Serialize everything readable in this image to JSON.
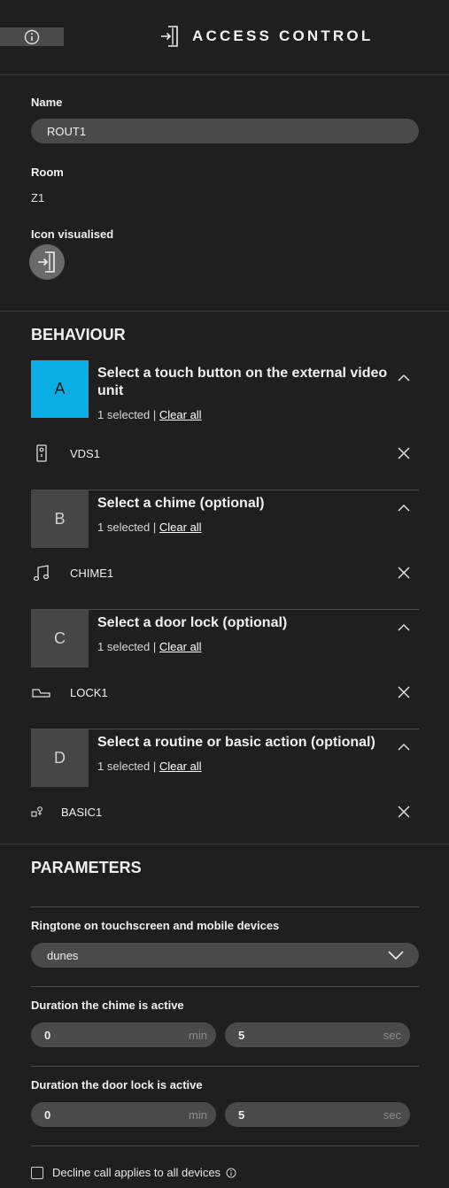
{
  "header": {
    "title": "ACCESS CONTROL",
    "info_icon": "info-icon",
    "title_icon": "access-door-icon"
  },
  "general": {
    "name_label": "Name",
    "name_value": "ROUT1",
    "room_label": "Room",
    "room_value": "Z1",
    "icon_label": "Icon visualised",
    "icon_name": "access-door-icon"
  },
  "behaviour": {
    "title": "BEHAVIOUR",
    "steps": [
      {
        "letter": "A",
        "title": "Select a touch button on the external video unit",
        "selected_text": "1 selected |",
        "clear_label": "Clear all",
        "item_label": "VDS1",
        "item_icon": "video-intercom-icon",
        "active": true
      },
      {
        "letter": "B",
        "title": "Select a chime (optional)",
        "selected_text": "1 selected |",
        "clear_label": "Clear all",
        "item_label": "CHIME1",
        "item_icon": "music-note-icon",
        "active": false
      },
      {
        "letter": "C",
        "title": "Select a door lock (optional)",
        "selected_text": "1 selected |",
        "clear_label": "Clear all",
        "item_label": "LOCK1",
        "item_icon": "door-lock-icon",
        "active": false
      },
      {
        "letter": "D",
        "title": "Select a routine or basic action (optional)",
        "selected_text": "1 selected |",
        "clear_label": "Clear all",
        "item_label": "BASIC1",
        "item_icon": "basic-action-icon",
        "active": false
      }
    ]
  },
  "parameters": {
    "title": "PARAMETERS",
    "ringtone_label": "Ringtone on touchscreen and mobile devices",
    "ringtone_value": "dunes",
    "chime_duration_label": "Duration the chime is active",
    "chime_min_value": "0",
    "chime_min_unit": "min",
    "chime_sec_value": "5",
    "chime_sec_unit": "sec",
    "lock_duration_label": "Duration the door lock is active",
    "lock_min_value": "0",
    "lock_min_unit": "min",
    "lock_sec_value": "5",
    "lock_sec_unit": "sec",
    "decline_label": "Decline call applies to all devices",
    "decline_checked": false
  },
  "colors": {
    "background": "#1f1f1f",
    "accent": "#0aaee8",
    "pill": "#4a4a4a"
  }
}
